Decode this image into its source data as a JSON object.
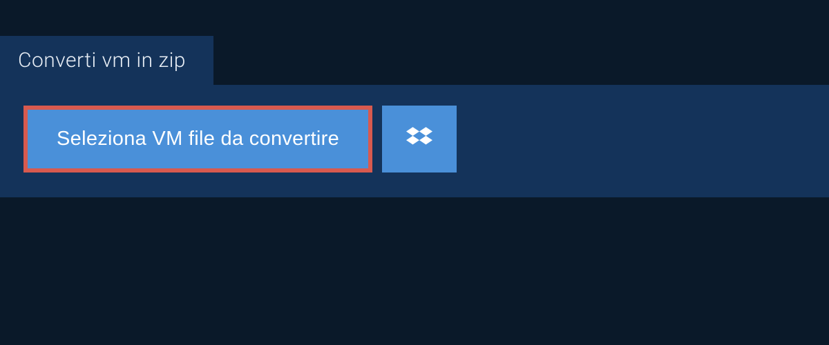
{
  "tab": {
    "label": "Converti vm in zip"
  },
  "actions": {
    "select_file_label": "Seleziona VM file da convertire"
  }
}
